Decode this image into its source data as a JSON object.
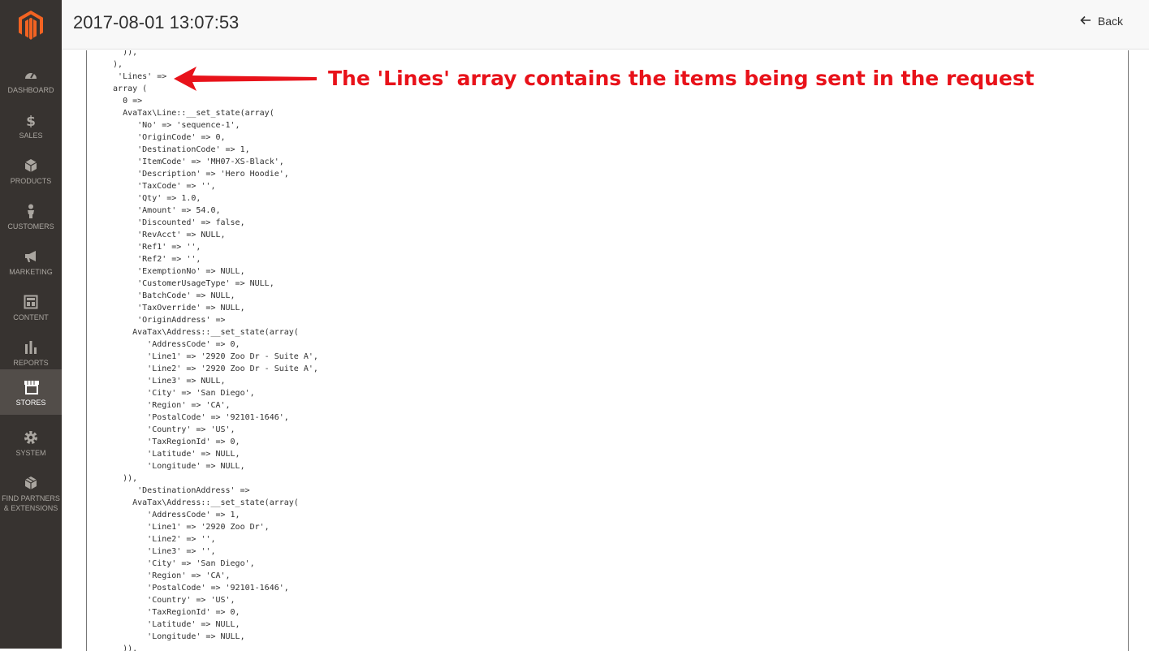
{
  "header": {
    "title": "2017-08-01 13:07:53",
    "back_label": "Back"
  },
  "sidebar": {
    "items": [
      {
        "label": "DASHBOARD",
        "icon": "dashboard-icon"
      },
      {
        "label": "SALES",
        "icon": "dollar-icon"
      },
      {
        "label": "PRODUCTS",
        "icon": "cube-icon"
      },
      {
        "label": "CUSTOMERS",
        "icon": "person-icon"
      },
      {
        "label": "MARKETING",
        "icon": "megaphone-icon"
      },
      {
        "label": "CONTENT",
        "icon": "layout-icon"
      },
      {
        "label": "REPORTS",
        "icon": "bar-chart-icon"
      },
      {
        "label": "STORES",
        "icon": "storefront-icon"
      },
      {
        "label": "SYSTEM",
        "icon": "gear-icon"
      },
      {
        "label": "FIND PARTNERS\n& EXTENSIONS",
        "icon": "box-icon"
      }
    ],
    "active": "STORES"
  },
  "annotation": {
    "text": "The 'Lines' array contains the items being sent in the request",
    "color": "#e8121a"
  },
  "code": "    )),\n  ),\n   'Lines' =>\n  array (\n    0 =>\n    AvaTax\\Line::__set_state(array(\n       'No' => 'sequence-1',\n       'OriginCode' => 0,\n       'DestinationCode' => 1,\n       'ItemCode' => 'MH07-XS-Black',\n       'Description' => 'Hero Hoodie',\n       'TaxCode' => '',\n       'Qty' => 1.0,\n       'Amount' => 54.0,\n       'Discounted' => false,\n       'RevAcct' => NULL,\n       'Ref1' => '',\n       'Ref2' => '',\n       'ExemptionNo' => NULL,\n       'CustomerUsageType' => NULL,\n       'BatchCode' => NULL,\n       'TaxOverride' => NULL,\n       'OriginAddress' =>\n      AvaTax\\Address::__set_state(array(\n         'AddressCode' => 0,\n         'Line1' => '2920 Zoo Dr - Suite A',\n         'Line2' => '2920 Zoo Dr - Suite A',\n         'Line3' => NULL,\n         'City' => 'San Diego',\n         'Region' => 'CA',\n         'PostalCode' => '92101-1646',\n         'Country' => 'US',\n         'TaxRegionId' => 0,\n         'Latitude' => NULL,\n         'Longitude' => NULL,\n    )),\n       'DestinationAddress' =>\n      AvaTax\\Address::__set_state(array(\n         'AddressCode' => 1,\n         'Line1' => '2920 Zoo Dr',\n         'Line2' => '',\n         'Line3' => '',\n         'City' => 'San Diego',\n         'Region' => 'CA',\n         'PostalCode' => '92101-1646',\n         'Country' => 'US',\n         'TaxRegionId' => 0,\n         'Latitude' => NULL,\n         'Longitude' => NULL,\n    )),"
}
